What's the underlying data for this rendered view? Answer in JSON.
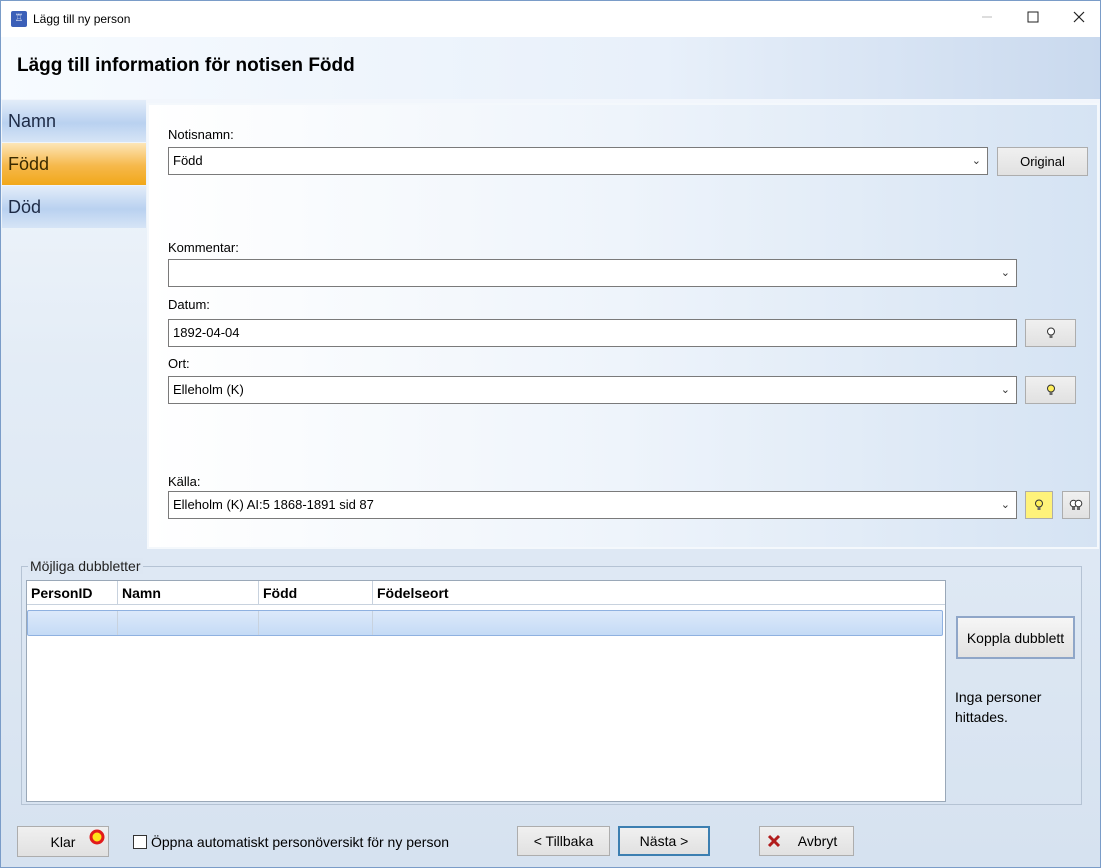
{
  "window": {
    "title": "Lägg till ny person",
    "minimize_icon": "minimize-icon",
    "maximize_icon": "maximize-icon",
    "close_icon": "close-icon"
  },
  "header": {
    "title": "Lägg till information för notisen Född"
  },
  "sidebar": {
    "items": [
      {
        "label": "Namn",
        "active": false
      },
      {
        "label": "Född",
        "active": true
      },
      {
        "label": "Död",
        "active": false
      }
    ]
  },
  "form": {
    "notisnamn": {
      "label": "Notisnamn:",
      "value": "Född",
      "original_button": "Original"
    },
    "kommentar": {
      "label": "Kommentar:",
      "value": ""
    },
    "datum": {
      "label": "Datum:",
      "value": "1892-04-04"
    },
    "ort": {
      "label": "Ort:",
      "value": "Elleholm (K)"
    },
    "kalla": {
      "label": "Källa:",
      "value": "Elleholm (K) AI:5 1868-1891 sid 87"
    }
  },
  "duplicates": {
    "title": "Möjliga dubbletter",
    "columns": [
      "PersonID",
      "Namn",
      "Född",
      "Födelseort"
    ],
    "rows": [],
    "link_button": "Koppla dubblett",
    "status": "Inga personer hittades."
  },
  "footer": {
    "klar": "Klar",
    "auto_open_checkbox": "Öppna automatiskt personöversikt för ny person",
    "back": "< Tillbaka",
    "next": "Nästa >",
    "cancel": "Avbryt"
  },
  "colors": {
    "active_nav": "#f4b02e",
    "nav_blue": "#b9d1f0",
    "bulb_yellow": "#ffef5a"
  }
}
